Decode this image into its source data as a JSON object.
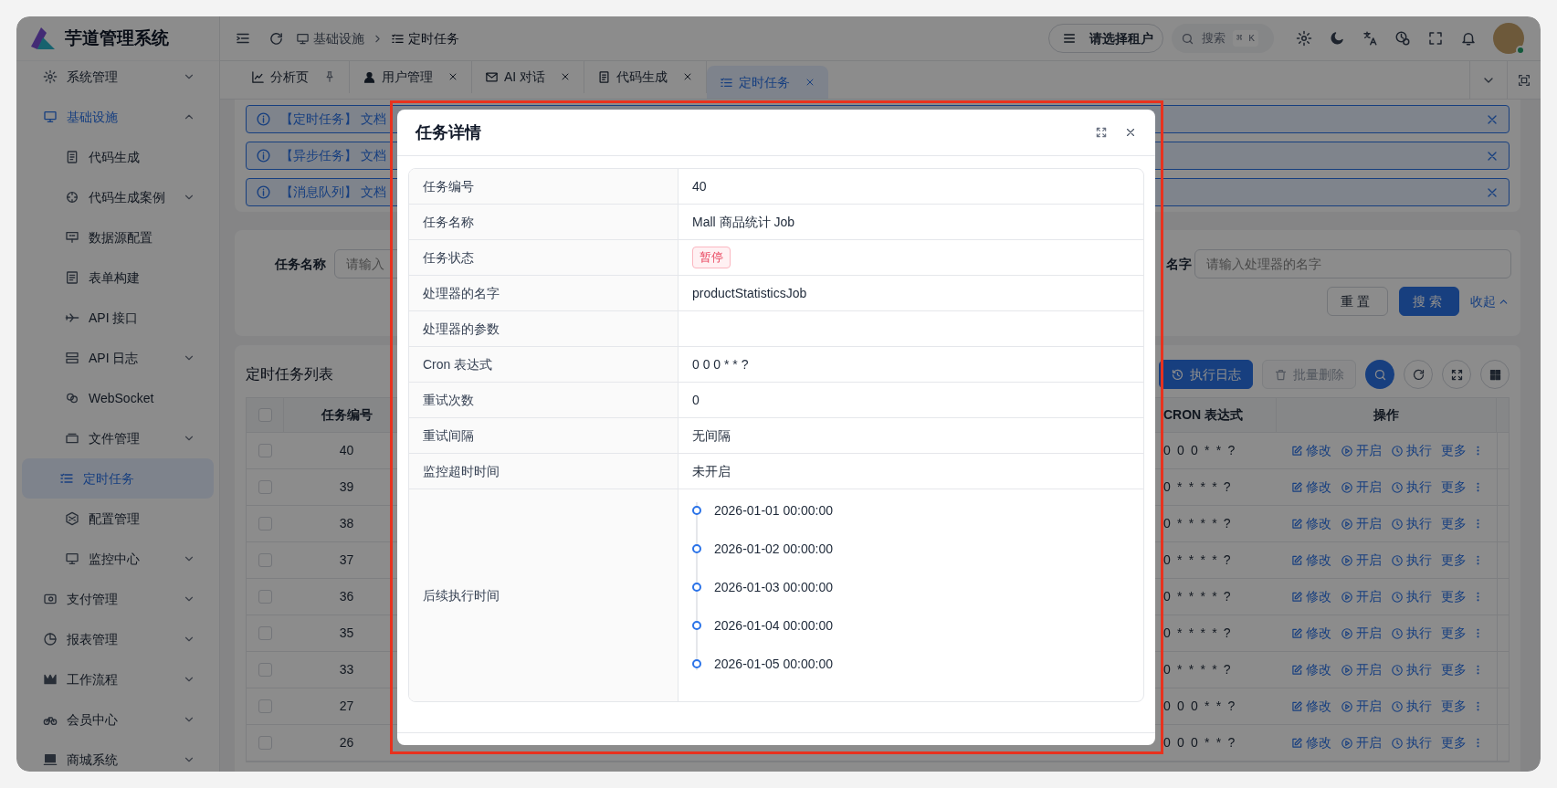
{
  "app": {
    "title": "芋道管理系统"
  },
  "sidebar": {
    "items": [
      {
        "label": "系统管理",
        "kind": "group",
        "expanded": false,
        "selected": false
      },
      {
        "label": "基础设施",
        "kind": "group",
        "expanded": true,
        "selected": false,
        "children": [
          {
            "label": "代码生成",
            "kind": "item",
            "selected": false
          },
          {
            "label": "代码生成案例",
            "kind": "group",
            "expanded": false,
            "selected": false
          },
          {
            "label": "数据源配置",
            "kind": "item",
            "selected": false
          },
          {
            "label": "表单构建",
            "kind": "item",
            "selected": false
          },
          {
            "label": "API 接口",
            "kind": "item",
            "selected": false
          },
          {
            "label": "API 日志",
            "kind": "group",
            "expanded": false,
            "selected": false
          },
          {
            "label": "WebSocket",
            "kind": "item",
            "selected": false
          },
          {
            "label": "文件管理",
            "kind": "group",
            "expanded": false,
            "selected": false
          },
          {
            "label": "定时任务",
            "kind": "item",
            "selected": true
          },
          {
            "label": "配置管理",
            "kind": "item",
            "selected": false
          },
          {
            "label": "监控中心",
            "kind": "group",
            "expanded": false,
            "selected": false
          }
        ]
      },
      {
        "label": "支付管理",
        "kind": "group",
        "expanded": false,
        "selected": false
      },
      {
        "label": "报表管理",
        "kind": "group",
        "expanded": false,
        "selected": false
      },
      {
        "label": "工作流程",
        "kind": "group",
        "expanded": false,
        "selected": false
      },
      {
        "label": "会员中心",
        "kind": "group",
        "expanded": false,
        "selected": false
      },
      {
        "label": "商城系统",
        "kind": "group",
        "expanded": false,
        "selected": false
      }
    ]
  },
  "header": {
    "breadcrumb": [
      "基础设施",
      "定时任务"
    ],
    "tenant": "请选择租户",
    "search": {
      "label": "搜索",
      "shortcut": "⌘ K"
    }
  },
  "tabs": [
    {
      "label": "分析页",
      "kind": "pinned",
      "selected": false
    },
    {
      "label": "用户管理",
      "kind": "closable",
      "selected": false
    },
    {
      "label": "AI 对话",
      "kind": "closable",
      "selected": false
    },
    {
      "label": "代码生成",
      "kind": "closable",
      "selected": false
    },
    {
      "label": "定时任务",
      "kind": "closable",
      "selected": true
    }
  ],
  "alerts": [
    {
      "text": "【定时任务】 文档"
    },
    {
      "text": "【异步任务】 文档"
    },
    {
      "text": "【消息队列】 文档"
    }
  ],
  "search_form": {
    "fields": [
      {
        "label": "任务名称",
        "placeholder": "请输入"
      },
      {
        "label": "名字",
        "placeholder": "请输入处理器的名字"
      }
    ],
    "buttons": [
      {
        "label": "重置",
        "kind": "default"
      },
      {
        "label": "搜索",
        "kind": "primary"
      }
    ],
    "collapse": "收起"
  },
  "table_card": {
    "title": "定时任务列表",
    "toolbar": [
      {
        "kind": "primary",
        "label": "执行日志",
        "disabled": false
      },
      {
        "kind": "default",
        "label": "批量删除",
        "disabled": true
      },
      {
        "kind": "icon-primary",
        "disabled": false
      },
      {
        "kind": "icon",
        "disabled": false
      },
      {
        "kind": "icon",
        "disabled": false
      },
      {
        "kind": "icon",
        "disabled": false
      }
    ],
    "table": {
      "select_all": false,
      "columns": [
        {
          "label": "任务编号"
        },
        {
          "label": "CRON 表达式"
        },
        {
          "label": "操作"
        }
      ],
      "rows": [
        {
          "checked": false,
          "id": "40",
          "cron": "0 0 0 * * ?",
          "actions": [
            "修改",
            "开启",
            "执行",
            "更多"
          ]
        },
        {
          "checked": false,
          "id": "39",
          "cron": "0 * * * * ?",
          "actions": [
            "修改",
            "开启",
            "执行",
            "更多"
          ]
        },
        {
          "checked": false,
          "id": "38",
          "cron": "0 * * * * ?",
          "actions": [
            "修改",
            "开启",
            "执行",
            "更多"
          ]
        },
        {
          "checked": false,
          "id": "37",
          "cron": "0 * * * * ?",
          "actions": [
            "修改",
            "开启",
            "执行",
            "更多"
          ]
        },
        {
          "checked": false,
          "id": "36",
          "cron": "0 * * * * ?",
          "actions": [
            "修改",
            "开启",
            "执行",
            "更多"
          ]
        },
        {
          "checked": false,
          "id": "35",
          "cron": "0 * * * * ?",
          "actions": [
            "修改",
            "开启",
            "执行",
            "更多"
          ]
        },
        {
          "checked": false,
          "id": "33",
          "cron": "0 * * * * ?",
          "actions": [
            "修改",
            "开启",
            "执行",
            "更多"
          ]
        },
        {
          "checked": false,
          "id": "27",
          "cron": "0 0 0 * * ?",
          "actions": [
            "修改",
            "开启",
            "执行",
            "更多"
          ]
        },
        {
          "checked": false,
          "id": "26",
          "cron": "0 0 0 * * ?",
          "actions": [
            "修改",
            "开启",
            "执行",
            "更多"
          ]
        }
      ]
    }
  },
  "dialog": {
    "title": "任务详情",
    "fields": [
      {
        "label": "任务编号",
        "kind": "text",
        "value": "40"
      },
      {
        "label": "任务名称",
        "kind": "text",
        "value": "Mall 商品统计 Job"
      },
      {
        "label": "任务状态",
        "kind": "tag",
        "value": "暂停"
      },
      {
        "label": "处理器的名字",
        "kind": "text",
        "value": "productStatisticsJob"
      },
      {
        "label": "处理器的参数",
        "kind": "text"
      },
      {
        "label": "Cron 表达式",
        "kind": "text",
        "value": "0 0 0 * * ?"
      },
      {
        "label": "重试次数",
        "kind": "text",
        "value": "0"
      },
      {
        "label": "重试间隔",
        "kind": "text",
        "value": "无间隔"
      },
      {
        "label": "监控超时时间",
        "kind": "text",
        "value": "未开启"
      },
      {
        "label": "后续执行时间",
        "kind": "timeline",
        "times": [
          "2026-01-01 00:00:00",
          "2026-01-02 00:00:00",
          "2026-01-03 00:00:00",
          "2026-01-04 00:00:00",
          "2026-01-05 00:00:00"
        ]
      }
    ]
  }
}
